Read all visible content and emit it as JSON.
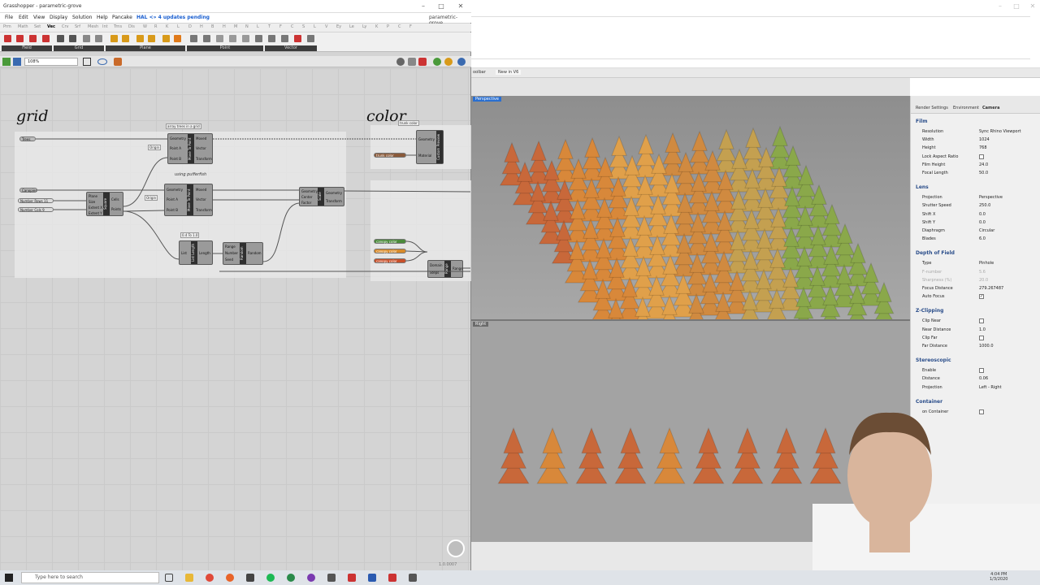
{
  "grasshopper": {
    "title": "Grasshopper - parametric-grove",
    "doc_name": "parametric-grove",
    "menu": [
      "File",
      "Edit",
      "View",
      "Display",
      "Solution",
      "Help",
      "Pancake"
    ],
    "hal_notice": "HAL <» 4 updates pending",
    "tabs": [
      "Prm",
      "Math",
      "Set",
      "Vec",
      "Crv",
      "Srf",
      "Mesh",
      "Int",
      "Trns",
      "Dis",
      "W",
      "R",
      "K",
      "L",
      "D",
      "H",
      "B",
      "H",
      "M",
      "N",
      "L",
      "T",
      "F",
      "C",
      "S",
      "L",
      "V",
      "Ey",
      "Le",
      "Ly",
      "K",
      "P",
      "C",
      "F"
    ],
    "ribbon_groups": [
      "Field",
      "Grid",
      "Plane",
      "Point",
      "Vector"
    ],
    "zoom": "108%",
    "labels": {
      "grid": "grid",
      "color": "color"
    },
    "notes": {
      "array": "array trees in a grid",
      "using": "using pufferfish",
      "origin1": "Origin",
      "origin2": "Origin",
      "random": "0.4 To 1.0",
      "trunk_color": "trunk color",
      "trunk_color2": "trunk color"
    },
    "params": {
      "trees": "Trees",
      "canopies": "Canopies",
      "number_rows": "Number Rows",
      "number_rows_val": "11",
      "number_cols": "Number Cols",
      "number_cols_val": "9",
      "canopy1": "canopy color",
      "canopy2": "canopy color",
      "canopy3": "canopy color"
    },
    "components": {
      "move_to_point_1": {
        "name": "Move To Point",
        "inputs": [
          "Geometry",
          "Point A",
          "Point B"
        ],
        "outputs": [
          "Moved",
          "Vector",
          "Transform"
        ]
      },
      "move_to_point_2": {
        "name": "Move To Point",
        "inputs": [
          "Geometry",
          "Point A",
          "Point B"
        ],
        "outputs": [
          "Moved",
          "Vector",
          "Transform"
        ]
      },
      "square": {
        "name": "Square",
        "inputs": [
          "Plane",
          "Size",
          "Extent X",
          "Extent Y"
        ],
        "outputs": [
          "Cells",
          "Points"
        ]
      },
      "scale": {
        "name": "Scale",
        "inputs": [
          "Geometry",
          "Center",
          "Factor"
        ],
        "outputs": [
          "Geometry",
          "Transform"
        ]
      },
      "list_length": {
        "name": "List Length",
        "inputs": [
          "List"
        ],
        "outputs": [
          "Length"
        ]
      },
      "random": {
        "name": "Random",
        "inputs": [
          "Range",
          "Number",
          "Seed"
        ],
        "outputs": [
          "Random"
        ]
      },
      "custom_preview_1": {
        "name": "Custom Preview",
        "inputs": [
          "Geometry",
          "Material"
        ]
      },
      "custom_preview_2": {
        "name": "Range",
        "inputs": [
          "Domain",
          "Steps"
        ],
        "outputs": [
          "Range"
        ]
      }
    },
    "status": "1.0.0007"
  },
  "rhino": {
    "toolbar_tabs": [
      "oolbar",
      "New in V6"
    ],
    "viewport_top": "Perspective",
    "viewport_bottom": "Right",
    "panel": {
      "tabs": [
        "Render Settings",
        "Environment",
        "Camera"
      ],
      "sections": [
        {
          "title": "Film",
          "rows": [
            [
              "Resolution",
              "Sync Rhino Viewport"
            ],
            [
              "Width",
              "1024"
            ],
            [
              "Height",
              "768"
            ],
            [
              "Lock Aspect Ratio",
              ""
            ],
            [
              "Film Height",
              "24.0"
            ],
            [
              "Focal Length",
              "50.0"
            ]
          ]
        },
        {
          "title": "Lens",
          "rows": [
            [
              "Projection",
              "Perspective"
            ],
            [
              "Shutter Speed",
              "250.0"
            ],
            [
              "Shift X",
              "0.0"
            ],
            [
              "Shift Y",
              "0.0"
            ],
            [
              "Diaphragm",
              "Circular"
            ],
            [
              "Blades",
              "6.0"
            ]
          ]
        },
        {
          "title": "Depth of Field",
          "rows": [
            [
              "Type",
              "Pinhole"
            ],
            [
              "F-number",
              "5.6"
            ],
            [
              "Sharpness (%)",
              "20.0"
            ],
            [
              "Focus Distance",
              "279.267487"
            ],
            [
              "Auto Focus",
              "✓"
            ]
          ]
        },
        {
          "title": "Z-Clipping",
          "rows": [
            [
              "Clip Near",
              ""
            ],
            [
              "Near Distance",
              "1.0"
            ],
            [
              "Clip Far",
              ""
            ],
            [
              "Far Distance",
              "1000.0"
            ]
          ]
        },
        {
          "title": "Stereoscopic",
          "rows": [
            [
              "Enable",
              ""
            ],
            [
              "Distance",
              "0.06"
            ],
            [
              "Projection",
              "Left - Right"
            ]
          ]
        },
        {
          "title": "Container",
          "rows": [
            [
              "on Container",
              ""
            ]
          ]
        }
      ]
    }
  },
  "taskbar": {
    "search_placeholder": "Type here to search",
    "time": "4:04 PM",
    "date": "1/3/2020"
  }
}
